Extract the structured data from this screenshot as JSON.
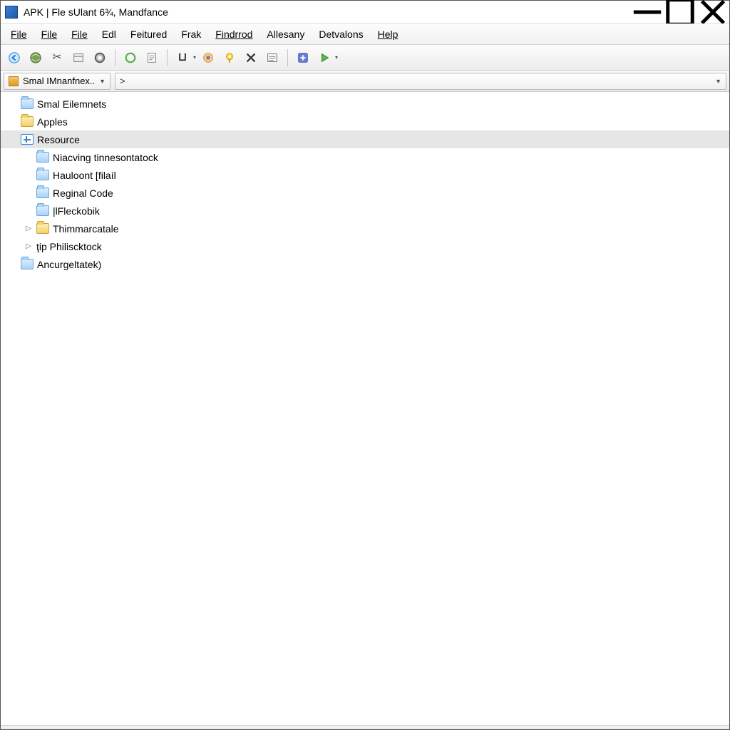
{
  "window": {
    "title": "APK | Fle sUlant 6¾, Mandfance"
  },
  "menu": {
    "items": [
      "File",
      "File",
      "File",
      "Edl",
      "Feitured",
      "Frak",
      "Findrrod",
      "Allesany",
      "Detvalons",
      "Help"
    ]
  },
  "toolbar": {
    "icons": [
      "nav-back",
      "globe",
      "scissors",
      "panel",
      "ring-dark",
      "sep",
      "ring-green",
      "note",
      "sep",
      "u-tool",
      "gear-color",
      "pin-yellow",
      "x-dark",
      "list",
      "sep",
      "plus-box",
      "play"
    ]
  },
  "combobar": {
    "project_label": "Smal IMnanfnex..",
    "path_text": ">"
  },
  "tree": {
    "nodes": [
      {
        "label": "Smal Eilemnets",
        "depth": 0,
        "icon": "folder-blue",
        "expander": "",
        "selected": false
      },
      {
        "label": "Apples",
        "depth": 0,
        "icon": "folder-yellow",
        "expander": "",
        "selected": false
      },
      {
        "label": "Resource",
        "depth": 0,
        "icon": "icon-plusbox",
        "expander": "",
        "selected": true
      },
      {
        "label": "Niacving tinnesontatock",
        "depth": 1,
        "icon": "folder-blue",
        "expander": "",
        "selected": false
      },
      {
        "label": "Hauloont [filaíl",
        "depth": 1,
        "icon": "folder-blue",
        "expander": "",
        "selected": false
      },
      {
        "label": "Reginal Code",
        "depth": 1,
        "icon": "folder-blue",
        "expander": "",
        "selected": false
      },
      {
        "label": "|lFleckobik",
        "depth": 1,
        "icon": "folder-blue",
        "expander": "",
        "selected": false
      },
      {
        "label": "Thimmarcatale",
        "depth": 1,
        "icon": "folder-yellow",
        "expander": "▷",
        "selected": false
      },
      {
        "label": "ţip Philiscktock",
        "depth": 1,
        "icon": "",
        "expander": "▷",
        "selected": false
      },
      {
        "label": "Ancurgeltatek)",
        "depth": 0,
        "icon": "folder-blue",
        "expander": "",
        "selected": false
      }
    ]
  }
}
